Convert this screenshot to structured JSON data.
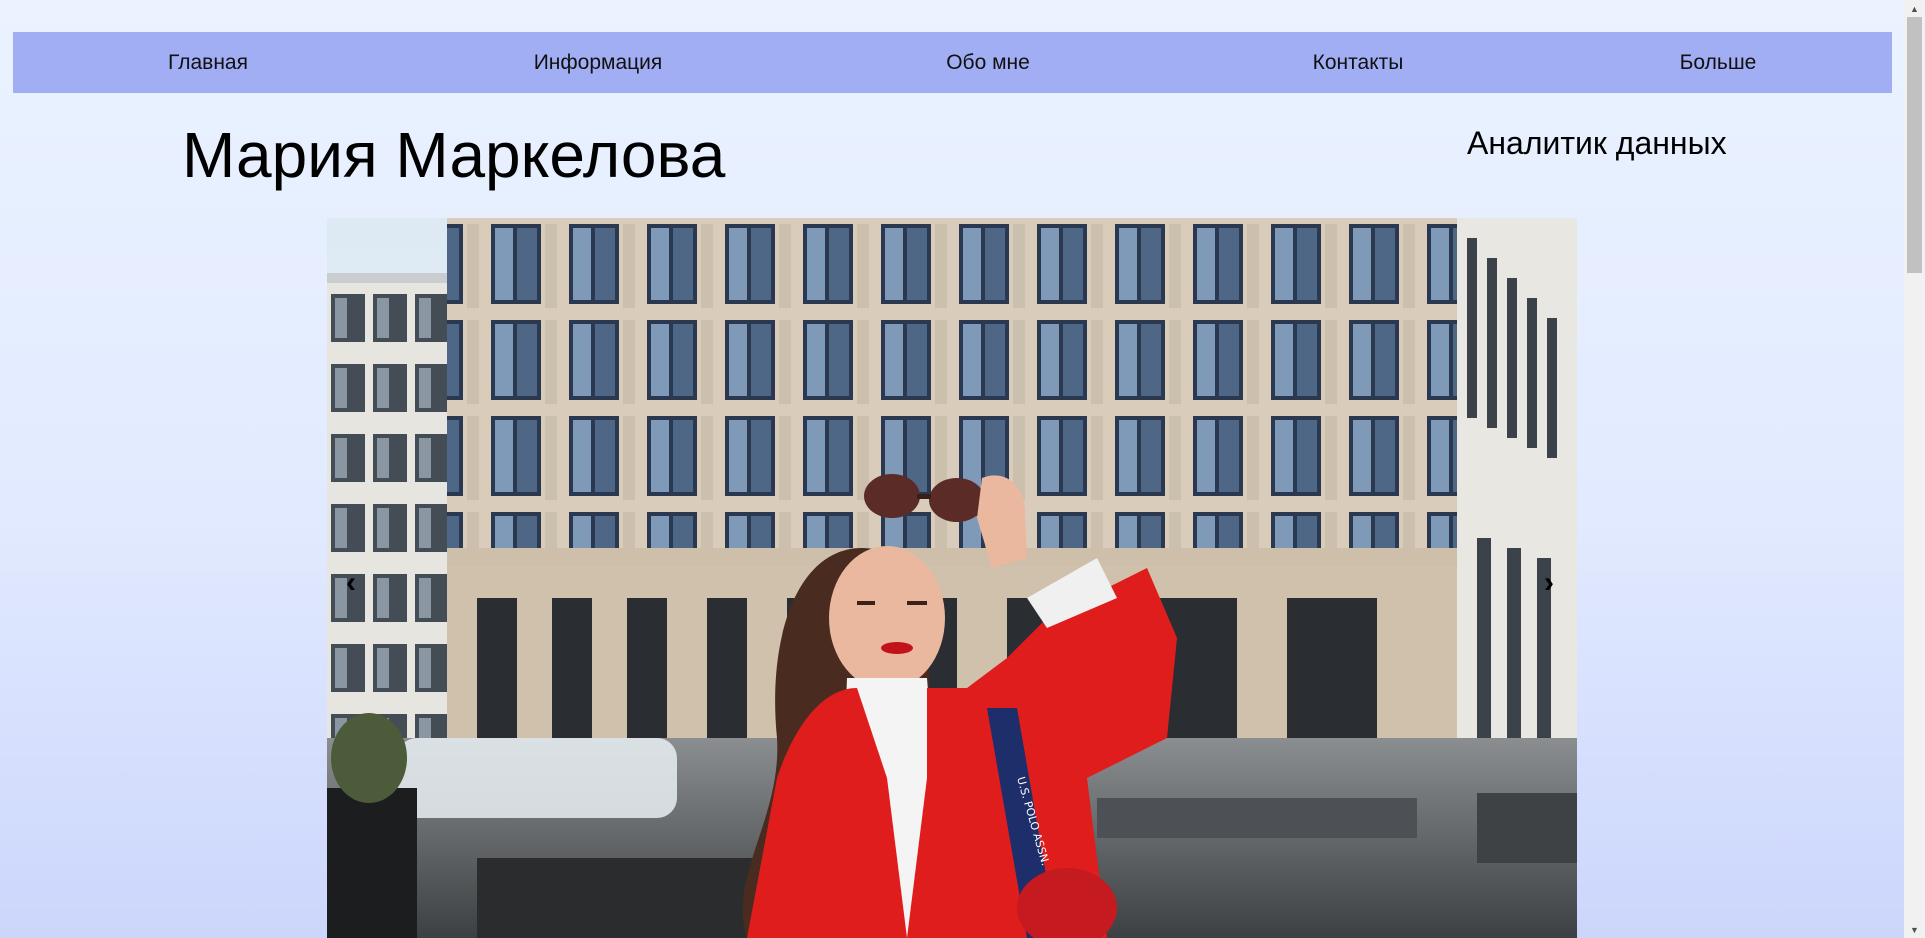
{
  "nav": {
    "items": [
      {
        "label": "Главная"
      },
      {
        "label": "Информация"
      },
      {
        "label": "Обо мне"
      },
      {
        "label": "Контакты"
      },
      {
        "label": "Больше"
      }
    ]
  },
  "header": {
    "name": "Мария Маркелова",
    "role": "Аналитик данных"
  },
  "carousel": {
    "prev_icon": "‹",
    "next_icon": "›"
  },
  "colors": {
    "nav_bg": "#a1aef4",
    "page_bg_top": "#eaf3ff",
    "page_bg_bottom": "#ccd6fb",
    "coat": "#e01d1d"
  }
}
